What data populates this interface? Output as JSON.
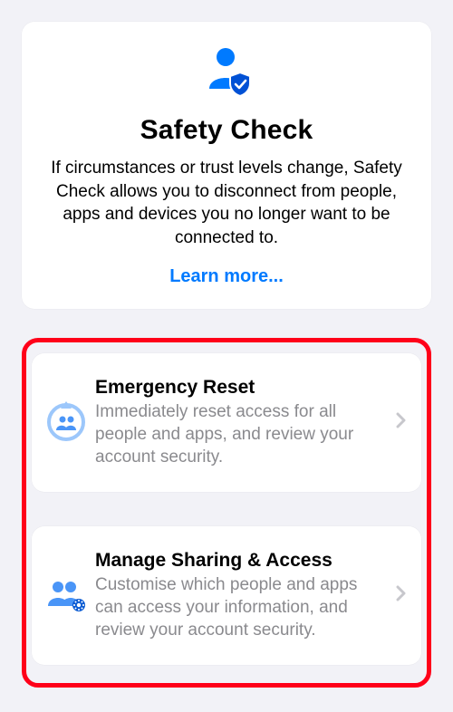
{
  "hero": {
    "title": "Safety Check",
    "description": "If circumstances or trust levels change, Safety Check allows you to disconnect from people, apps and devices you no longer want to be connected to.",
    "learn_more": "Learn more..."
  },
  "options": {
    "emergency": {
      "title": "Emergency Reset",
      "subtitle": "Immediately reset access for all people and apps, and review your account security."
    },
    "manage": {
      "title": "Manage Sharing & Access",
      "subtitle": "Customise which people and apps can access your information, and review your account security."
    }
  },
  "colors": {
    "accent": "#007AFF",
    "highlight_border": "#FF0019"
  }
}
